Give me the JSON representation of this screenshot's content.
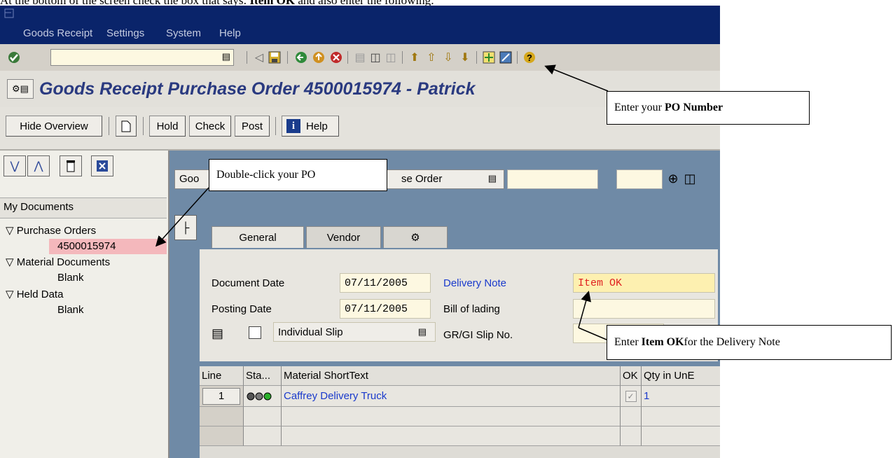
{
  "instruction": {
    "text_before": "At the bottom of the screen check the box that says: ",
    "strong1": "Item OK",
    "text_after": " and also enter the following:"
  },
  "menu": [
    "Goods Receipt",
    "Settings",
    "System",
    "Help"
  ],
  "page_title": "Goods Receipt Purchase Order 4500015974 - Patrick",
  "app_toolbar": {
    "hide_overview": "Hide Overview",
    "hold": "Hold",
    "check": "Check",
    "post": "Post",
    "help": "Help"
  },
  "tree": {
    "root": "My Documents",
    "purchase_orders": "Purchase Orders",
    "po_number": "4500015974",
    "material_documents": "Material Documents",
    "blank1": "Blank",
    "held_data": "Held Data",
    "blank2": "Blank"
  },
  "selector": {
    "action_prefix": "Goo",
    "ref_doc": "se Order"
  },
  "tabs": [
    "General",
    "Vendor"
  ],
  "form": {
    "document_date_label": "Document Date",
    "document_date": "07/11/2005",
    "posting_date_label": "Posting Date",
    "posting_date": "07/11/2005",
    "slip_option": "Individual Slip",
    "delivery_note_label": "Delivery Note",
    "delivery_note": "Item OK",
    "bill_of_lading_label": "Bill of lading",
    "bill_of_lading": "",
    "gr_slip_label": "GR/GI Slip No."
  },
  "grid": {
    "headers": [
      "Line",
      "Sta...",
      "Material ShortText",
      "OK",
      "Qty in UnE"
    ],
    "rows": [
      {
        "line": "1",
        "material": "Caffrey Delivery Truck",
        "qty": "1"
      }
    ]
  },
  "callouts": {
    "po_prefix": "Enter your ",
    "po_strong": "PO Number",
    "double_click": "Double-click your PO",
    "dn_prefix": "Enter ",
    "dn_strong": "Item OK",
    "dn_suffix": " for the Delivery Note"
  },
  "colors": {
    "menubar": "#0a246a",
    "title": "#2a3a80",
    "link": "#1a3acc",
    "highlight_po": "#f4b8bc",
    "field_yellow": "#fdf5c4"
  }
}
